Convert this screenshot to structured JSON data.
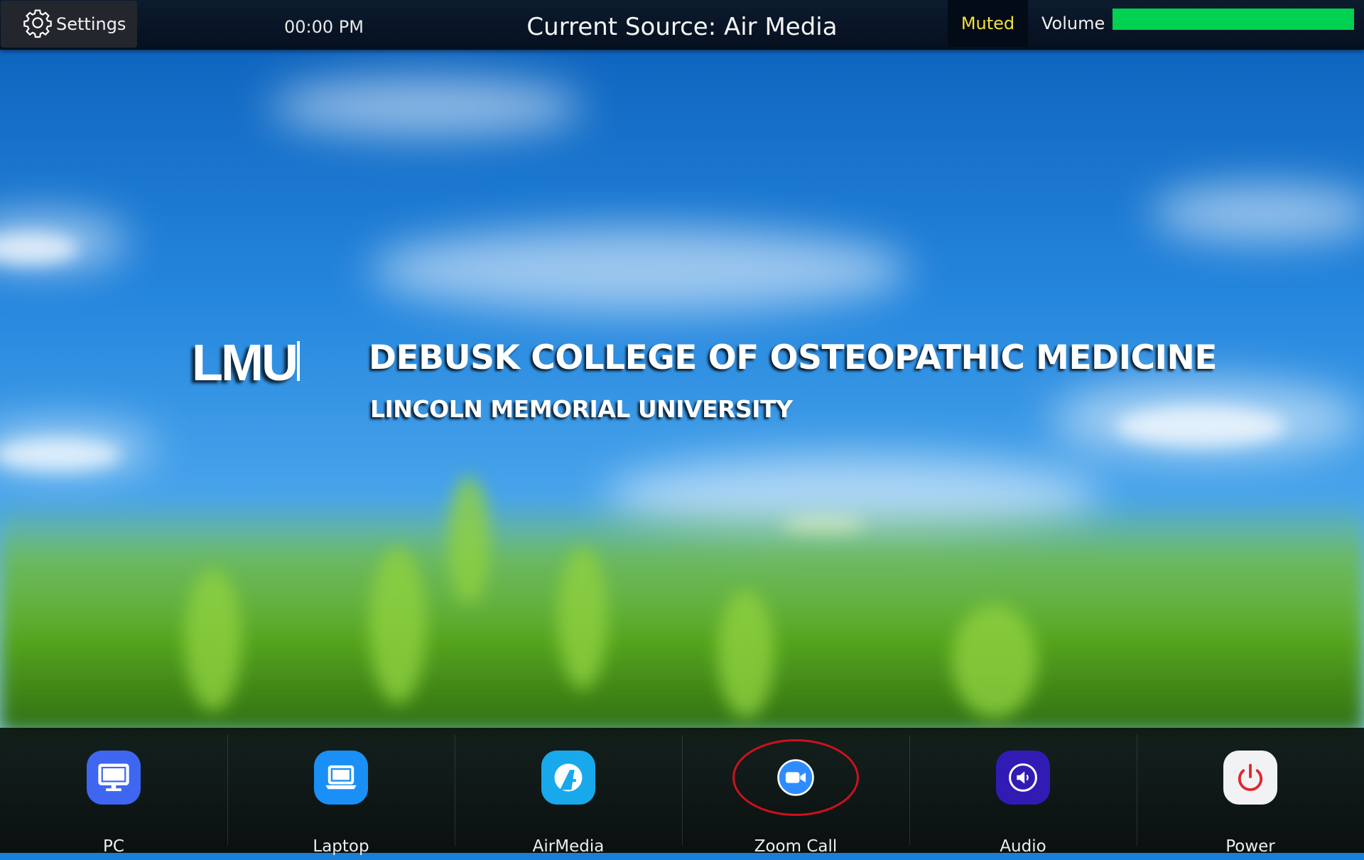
{
  "header": {
    "settings_label": "Settings",
    "clock": "00:00 PM",
    "current_source": "Current Source: Air Media",
    "muted_label": "Muted",
    "volume_label": "Volume",
    "volume_level_percent": 100
  },
  "branding": {
    "logo_text": "LMU",
    "college_title": "DEBUSK COLLEGE OF OSTEOPATHIC MEDICINE",
    "university_name": "LINCOLN MEMORIAL UNIVERSITY"
  },
  "sources": [
    {
      "label": "PC",
      "icon": "monitor-icon",
      "color": "#3e66f0"
    },
    {
      "label": "Laptop",
      "icon": "laptop-icon",
      "color": "#1a8ff5"
    },
    {
      "label": "AirMedia",
      "icon": "airmedia-icon",
      "color": "#18a9ec"
    },
    {
      "label": "Zoom Call",
      "icon": "zoom-camera-icon",
      "color": "#2f8cff"
    },
    {
      "label": "Audio",
      "icon": "speaker-icon",
      "color": "#311bb5"
    },
    {
      "label": "Power",
      "icon": "power-icon",
      "color": "#f2f2f4"
    }
  ],
  "colors": {
    "muted_text": "#f4e03a",
    "volume_fill": "#00d150",
    "highlight_ring": "#d0101c",
    "power_symbol": "#e0282f"
  }
}
